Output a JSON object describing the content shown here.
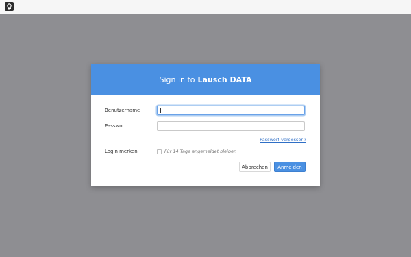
{
  "dialog": {
    "title_prefix": "Sign in to",
    "app_name": "Lausch DATA"
  },
  "form": {
    "username_label": "Benutzername",
    "username_value": "",
    "password_label": "Passwort",
    "password_value": "",
    "forgot_link": "Passwort vergessen?",
    "remember_label": "Login merken",
    "remember_hint": "Für 14 Tage angemeldet bleiben",
    "remember_checked": false
  },
  "buttons": {
    "cancel": "Abbrechen",
    "submit": "Anmelden"
  },
  "colors": {
    "accent": "#4a90e2",
    "backdrop": "#8e8e92",
    "link": "#2f6fc6"
  },
  "icons": {
    "app": "app-logo-icon",
    "checkbox": "checkbox-icon"
  }
}
